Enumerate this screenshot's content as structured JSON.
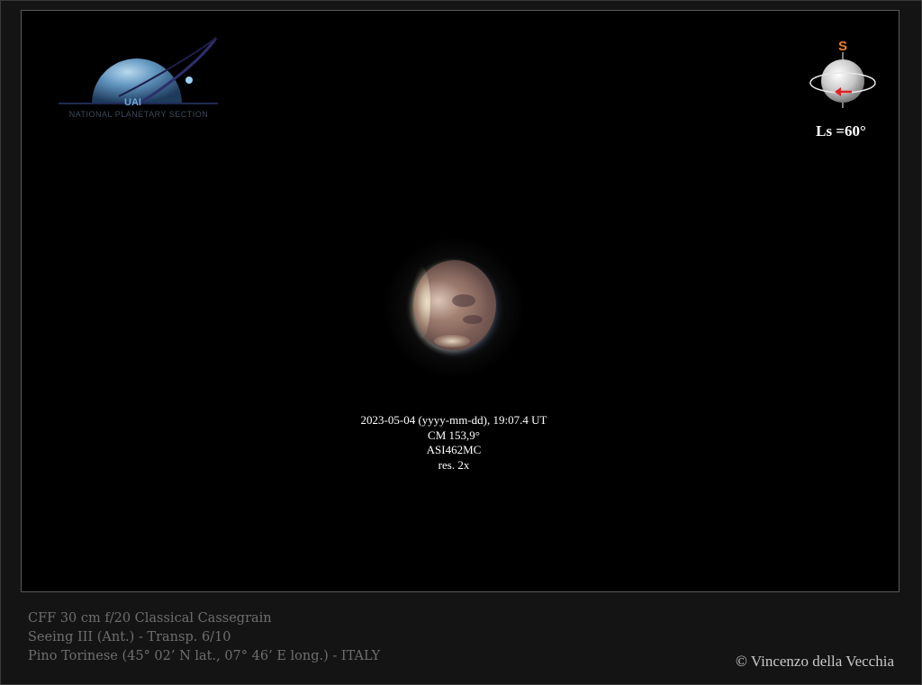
{
  "logo": {
    "brand": "UAI",
    "tagline": "NATIONAL PLANETARY SECTION",
    "icon": "saturn-logo-icon"
  },
  "orientation": {
    "south_label": "S",
    "ls_label": "Ls =60°",
    "icon": "orientation-globe-icon",
    "rotation_arrow_color": "#e02020",
    "south_marker_color": "#f08020"
  },
  "observation": {
    "datetime": "2023-05-04 (yyyy-mm-dd), 19:07.4 UT",
    "cm": "CM 153,9°",
    "camera": "ASI462MC",
    "resampling": "res. 2x"
  },
  "equipment": {
    "telescope": "CFF 30 cm f/20 Classical Cassegrain",
    "conditions": "Seeing  III (Ant.) - Transp. 6/10",
    "location": "Pino Torinese (45° 02’ N lat., 07° 46’ E long.) - ITALY"
  },
  "credit": "© Vincenzo della Vecchia"
}
